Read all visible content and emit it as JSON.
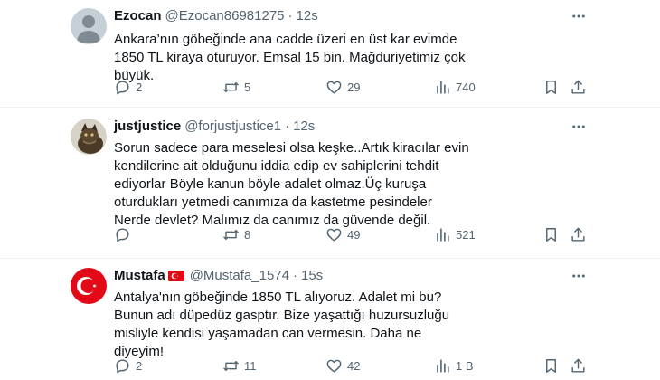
{
  "tweets": [
    {
      "name": "Ezocan",
      "handle": "@Ezocan86981275",
      "separator": "·",
      "time": "12s",
      "text": "Ankara’nın göbeğinde ana cadde üzeri en üst kar evimde 1850 TL kiraya oturuyor. Emsal 15 bin. Mağduriyetimiz çok büyük.",
      "replies": "2",
      "reposts": "5",
      "likes": "29",
      "views": "740"
    },
    {
      "name": "justjustice",
      "handle": "@forjustjustice1",
      "separator": "·",
      "time": "12s",
      "text": "Sorun sadece para meselesi olsa keşke..Artık kiracılar evin kendilerine ait olduğunu iddia edip ev sahiplerini tehdit ediyorlar Böyle kanun böyle adalet olmaz.Üç kuruşa oturdukları yetmedi canımıza da kastetme pesindeler Nerde devlet? Malımız da canımız da güvende değil.",
      "replies": "",
      "reposts": "8",
      "likes": "49",
      "views": "521"
    },
    {
      "name": "Mustafa",
      "handle": "@Mustafa_1574",
      "separator": "·",
      "time": "15s",
      "text": "Antalya'nın göbeğinde 1850 TL alıyoruz. Adalet mi bu? Bunun adı düpedüz gasptır. Bize yaşattığı huzursuzluğu misliyle kendisi yaşamadan can vermesin. Daha ne diyeyim!",
      "replies": "2",
      "reposts": "11",
      "likes": "42",
      "views": "1 B"
    }
  ],
  "icons": {
    "reply": "reply-icon",
    "repost": "repost-icon",
    "like": "like-icon",
    "views": "views-icon",
    "bookmark": "bookmark-icon",
    "share": "share-icon",
    "more": "more-icon"
  },
  "colors": {
    "text": "#0f1419",
    "secondary": "#536471",
    "divider": "#eff3f4",
    "flag_red": "#e30a17"
  }
}
